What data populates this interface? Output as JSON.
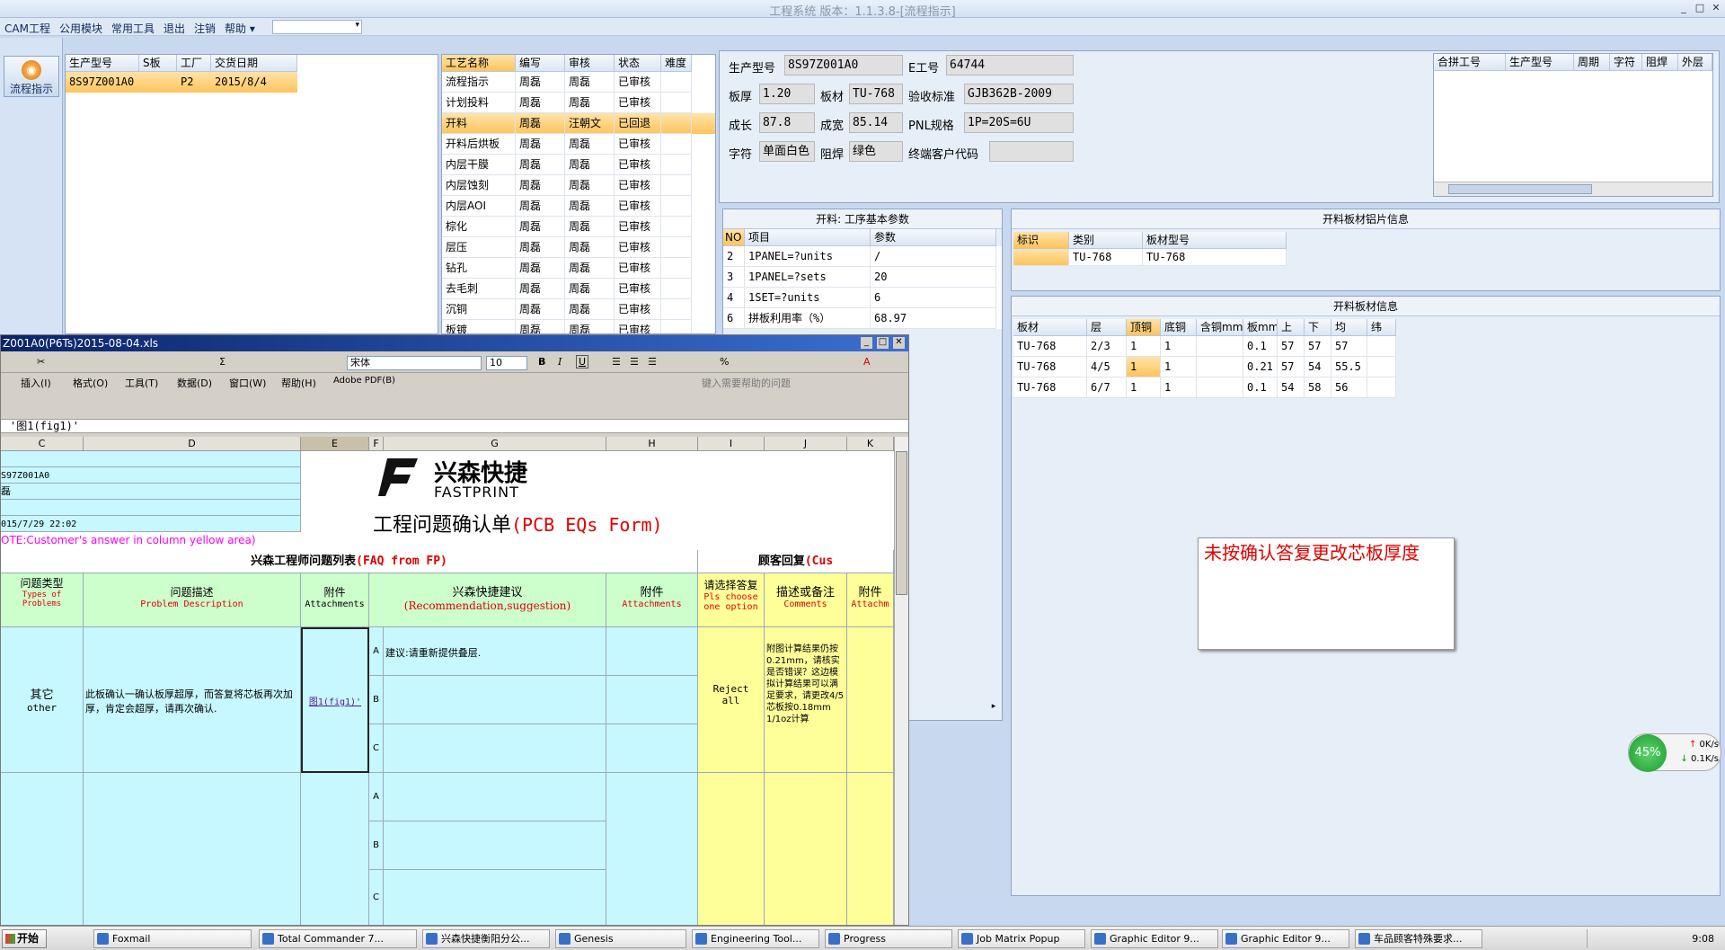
{
  "window": {
    "title": "工程系统 版本：1.1.3.8-[流程指示]"
  },
  "menu": {
    "items": [
      "CAM工程",
      "公用模块",
      "常用工具",
      "退出",
      "注销",
      "帮助 ▾"
    ]
  },
  "sidebar": {
    "flow_button": "流程指示"
  },
  "orders": {
    "headers": [
      "生产型号",
      "S板",
      "工厂",
      "交货日期"
    ],
    "rows": [
      [
        "8S97Z001A0",
        "",
        "P2",
        "2015/8/4"
      ]
    ]
  },
  "process": {
    "headers": [
      "工艺名称",
      "编写",
      "审核",
      "状态",
      "难度"
    ],
    "rows": [
      [
        "流程指示",
        "周磊",
        "周磊",
        "已审核",
        ""
      ],
      [
        "计划投料",
        "周磊",
        "周磊",
        "已审核",
        ""
      ],
      [
        "开料",
        "周磊",
        "汪朝文",
        "已回退",
        ""
      ],
      [
        "开料后烘板",
        "周磊",
        "周磊",
        "已审核",
        ""
      ],
      [
        "内层干膜",
        "周磊",
        "周磊",
        "已审核",
        ""
      ],
      [
        "内层蚀刻",
        "周磊",
        "周磊",
        "已审核",
        ""
      ],
      [
        "内层AOI",
        "周磊",
        "周磊",
        "已审核",
        ""
      ],
      [
        "棕化",
        "周磊",
        "周磊",
        "已审核",
        ""
      ],
      [
        "层压",
        "周磊",
        "周磊",
        "已审核",
        ""
      ],
      [
        "钻孔",
        "周磊",
        "周磊",
        "已审核",
        ""
      ],
      [
        "去毛刺",
        "周磊",
        "周磊",
        "已审核",
        ""
      ],
      [
        "沉铜",
        "周磊",
        "周磊",
        "已审核",
        ""
      ],
      [
        "板镀",
        "周磊",
        "周磊",
        "已审核",
        ""
      ]
    ]
  },
  "info": {
    "model_label": "生产型号",
    "model": "8S97Z001A0",
    "eno_label": "E工号",
    "eno": "64744",
    "thick_label": "板厚",
    "thick": "1.20",
    "mat_label": "板材",
    "mat": "TU-768",
    "std_label": "验收标准",
    "std": "GJB362B-2009",
    "len_label": "成长",
    "len": "87.8",
    "wid_label": "成宽",
    "wid": "85.14",
    "pnl_label": "PNL规格",
    "pnl": "1P=20S=6U",
    "char_label": "字符",
    "char": "单面白色",
    "mask_label": "阻焊",
    "mask": "绿色",
    "cust_label": "终端客户代码",
    "cust": ""
  },
  "merge": {
    "headers": [
      "合拼工号",
      "生产型号",
      "周期",
      "字符",
      "阻焊",
      "外层"
    ]
  },
  "params": {
    "title": "开料: 工序基本参数",
    "headers": [
      "NO",
      "项目",
      "参数"
    ],
    "rows": [
      [
        "2",
        "1PANEL=?units",
        "/"
      ],
      [
        "3",
        "1PANEL=?sets",
        "20"
      ],
      [
        "4",
        "1SET=?units",
        "6"
      ],
      [
        "6",
        "拼板利用率（%）",
        "68.97"
      ]
    ]
  },
  "cut": {
    "title": "开料板材铝片信息",
    "headers": [
      "标识",
      "类别",
      "板材型号"
    ],
    "rows": [
      [
        "",
        "TU-768",
        "TU-768"
      ]
    ]
  },
  "board": {
    "title": "开料板材信息",
    "headers": [
      "板材",
      "层",
      "顶铜",
      "底铜",
      "含铜mm",
      "板mm",
      "上",
      "下",
      "均",
      "纬"
    ],
    "rows": [
      [
        "TU-768",
        "2/3",
        "1",
        "1",
        "",
        "0.1",
        "57",
        "57",
        "57",
        ""
      ],
      [
        "TU-768",
        "4/5",
        "1",
        "1",
        "",
        "0.21",
        "57",
        "54",
        "55.5",
        ""
      ],
      [
        "TU-768",
        "6/7",
        "1",
        "1",
        "",
        "0.1",
        "54",
        "58",
        "56",
        ""
      ]
    ]
  },
  "note": {
    "text": "未按确认答复更改芯板厚度"
  },
  "excel": {
    "title": "Z001A0(P6Ts)2015-08-04.xls",
    "menu": [
      "插入(I)",
      "格式(O)",
      "工具(T)",
      "数据(D)",
      "窗口(W)",
      "帮助(H)",
      "Adobe PDF(B)"
    ],
    "help_placeholder": "键入需要帮助的问题",
    "font": "宋体",
    "size": "10",
    "formula": "'图1(fig1)'",
    "cols": [
      "C",
      "D",
      "E",
      "F",
      "G",
      "H",
      "I",
      "J",
      "K"
    ],
    "model": "S97Z001A0",
    "person": "磊",
    "date": "015/7/29 22:02",
    "note": "OTE:Customer's answer in column yellow area)",
    "brand_cn": "兴森快捷",
    "brand_en": "FASTPRINT",
    "form_title_cn": "工程问题确认单",
    "form_title_en": "(PCB EQs Form)",
    "faq_cn": "兴森工程师问题列表",
    "faq_en": "(FAQ from FP)",
    "cust_cn": "顾客回复",
    "cust_en": "(Cus",
    "h_type_cn": "问题类型",
    "h_type_en": "Types of Problems",
    "h_desc_cn": "问题描述",
    "h_desc_en": "Problem Description",
    "h_att_cn": "附件",
    "h_att_en": "Attachments",
    "h_sugg_cn": "兴森快捷建议",
    "h_sugg_en": "(Recommendation,suggestion)",
    "h_att2_cn": "附件",
    "h_att2_en": "Attachments",
    "h_choose_cn": "请选择答复",
    "h_choose_en": "Pls choose one option",
    "h_comm_cn": "描述或备注",
    "h_comm_en": "Comments",
    "h_att3_cn": "附件",
    "h_att3_en": "Attachm",
    "type_cn": "其它",
    "type_en": "other",
    "desc": "此板确认一确认板厚超厚，而答复将芯板再次加厚，肯定会超厚，请再次确认.",
    "attach_link": "图1(fig1)'",
    "sugg": "建议:请重新提供叠层.",
    "reply": "Reject all",
    "comment": "附图计算结果仍按0.21mm，请核实是否错误？这边模拟计算结果可以满足要求，请更改4/5芯板按0.18mm 1/1oz计算"
  },
  "widget": {
    "percent": "45%",
    "up": "0K/s",
    "down": "0.1K/s"
  },
  "taskbar": {
    "start": "开始",
    "items": [
      "Foxmail",
      "Total Commander 7...",
      "兴森快捷衡阳分公...",
      "Genesis",
      "Engineering Tool...",
      "Progress",
      "Job Matrix Popup",
      "Graphic Editor 9...",
      "Graphic Editor 9...",
      "车品顾客特殊要求..."
    ],
    "clock": "9:08"
  }
}
